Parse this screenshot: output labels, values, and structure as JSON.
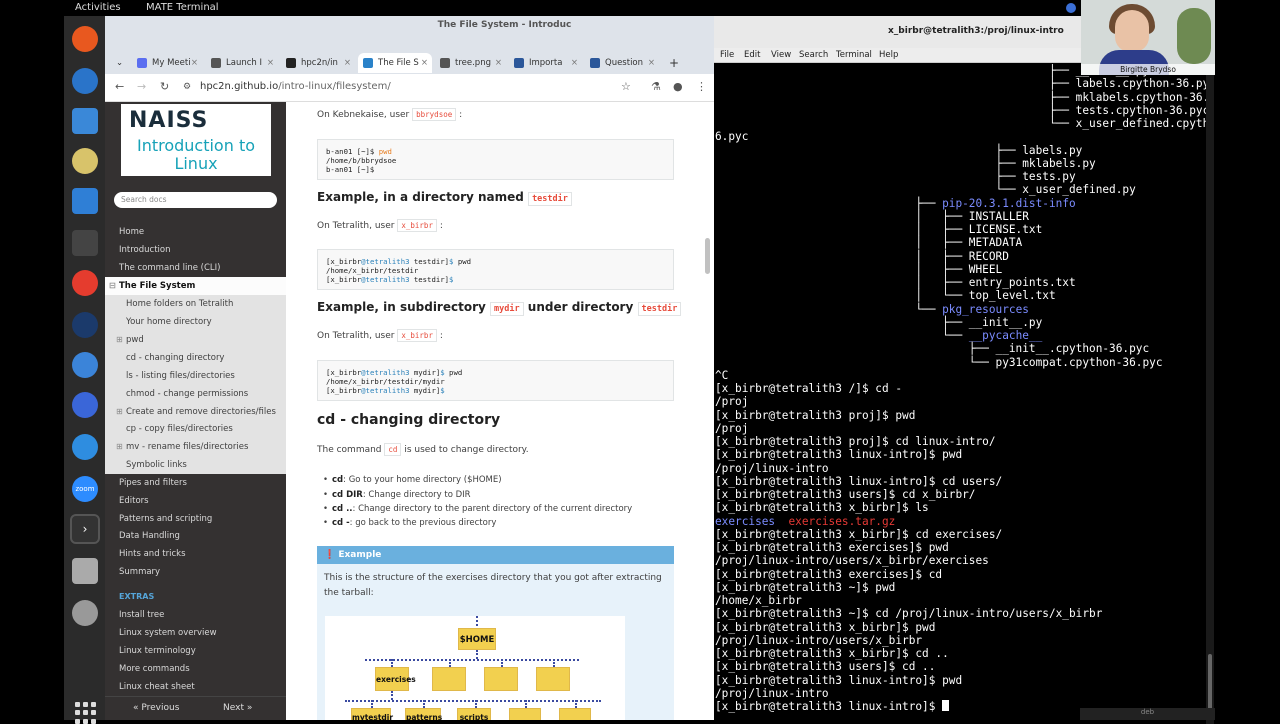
{
  "topbar": {
    "activities": "Activities",
    "app": "MATE Terminal"
  },
  "dock": [
    {
      "name": "firefox-icon",
      "color": "#e8581f"
    },
    {
      "name": "thunderbird-icon",
      "color": "#2a74c9"
    },
    {
      "name": "files-icon",
      "color": "#3a88d8"
    },
    {
      "name": "rhythmbox-icon",
      "color": "#d8c36a"
    },
    {
      "name": "writer-icon",
      "color": "#2f7fd6"
    },
    {
      "name": "system-monitor-icon",
      "color": "#444"
    },
    {
      "name": "help-icon",
      "color": "#e53c2e"
    },
    {
      "name": "steam-icon",
      "color": "#1b3a6b"
    },
    {
      "name": "chromium-icon",
      "color": "#3b84d9"
    },
    {
      "name": "signal-icon",
      "color": "#3a66d8"
    },
    {
      "name": "remote-icon",
      "color": "#2e8de0"
    },
    {
      "name": "zoom-icon",
      "color": "#2d8cff"
    },
    {
      "name": "terminal-icon",
      "color": "#333"
    },
    {
      "name": "usb-creator-icon",
      "color": "#aaa"
    },
    {
      "name": "trash-icon",
      "color": "#999"
    }
  ],
  "browser": {
    "window_title": "The File System - Introduc",
    "tabs": [
      {
        "label": "My Meeti",
        "color": "#5b6ef0"
      },
      {
        "label": "Launch I",
        "color": "#555"
      },
      {
        "label": "hpc2n/in",
        "color": "#222"
      },
      {
        "label": "The File S",
        "color": "#2a82c9"
      },
      {
        "label": "tree.png",
        "color": "#555"
      },
      {
        "label": "Importa",
        "color": "#2b579a"
      },
      {
        "label": "Question",
        "color": "#2b579a"
      }
    ],
    "new_tab": "+",
    "url_host": "hpc2n.github.io",
    "url_path": "/intro-linux/filesystem/"
  },
  "sidebar": {
    "logo_top": "NAISS",
    "logo_bottom": "Introduction to Linux",
    "search_placeholder": "Search docs",
    "items": [
      {
        "label": "Home",
        "kind": "top"
      },
      {
        "label": "Introduction",
        "kind": "top"
      },
      {
        "label": "The command line (CLI)",
        "kind": "top"
      },
      {
        "label": "The File System",
        "kind": "current",
        "toggle": "⊟"
      },
      {
        "label": "Home folders on Tetralith",
        "kind": "sub"
      },
      {
        "label": "Your home directory",
        "kind": "sub"
      },
      {
        "label": "pwd",
        "kind": "sub",
        "toggle": "⊞"
      },
      {
        "label": "cd - changing directory",
        "kind": "sub"
      },
      {
        "label": "ls - listing files/directories",
        "kind": "sub"
      },
      {
        "label": "chmod - change permissions",
        "kind": "sub"
      },
      {
        "label": "Create and remove directories/files",
        "kind": "sub",
        "toggle": "⊞"
      },
      {
        "label": "cp - copy files/directories",
        "kind": "sub"
      },
      {
        "label": "mv - rename files/directories",
        "kind": "sub",
        "toggle": "⊞"
      },
      {
        "label": "Symbolic links",
        "kind": "sub"
      },
      {
        "label": "Pipes and filters",
        "kind": "top"
      },
      {
        "label": "Editors",
        "kind": "top"
      },
      {
        "label": "Patterns and scripting",
        "kind": "top"
      },
      {
        "label": "Data Handling",
        "kind": "top"
      },
      {
        "label": "Hints and tricks",
        "kind": "top"
      },
      {
        "label": "Summary",
        "kind": "top"
      },
      {
        "label": "EXTRAS",
        "kind": "extras"
      },
      {
        "label": "Install tree",
        "kind": "top"
      },
      {
        "label": "Linux system overview",
        "kind": "top"
      },
      {
        "label": "Linux terminology",
        "kind": "top"
      },
      {
        "label": "More commands",
        "kind": "top"
      },
      {
        "label": "Linux cheat sheet",
        "kind": "top"
      }
    ],
    "prev": "« Previous",
    "next": "Next »"
  },
  "content": {
    "p_kebnekaise_pre": "On Kebnekaise, user",
    "user_kebnekaise": "bbrydsoe",
    "p_colon": ":",
    "block1": {
      "l1_prompt": "b-an01 [~]$ ",
      "l1_cmd": "pwd",
      "l2": "/home/b/bbrydsoe",
      "l3": "b-an01 [~]$"
    },
    "h_dir_pre": "Example, in a directory named",
    "h_dir_code": "testdir",
    "p_tetralith_pre": "On Tetralith, user",
    "user_tetralith": "x_birbr",
    "block2": {
      "l1a": "[x_birbr",
      "l1b": "@tetralith3",
      "l1c": " testdir]",
      "l1d": "$ ",
      "l1e": "pwd",
      "l2": "/home/x_birbr/testdir",
      "l3a": "[x_birbr",
      "l3b": "@tetralith3",
      "l3c": " testdir]",
      "l3d": "$"
    },
    "h_sub_pre": "Example, in subdirectory",
    "h_sub_code1": "mydir",
    "h_sub_mid": "under directory",
    "h_sub_code2": "testdir",
    "block3": {
      "l1a": "[x_birbr",
      "l1b": "@tetralith3",
      "l1c": " mydir]",
      "l1d": "$ ",
      "l1e": "pwd",
      "l2": "/home/x_birbr/testdir/mydir",
      "l3a": "[x_birbr",
      "l3b": "@tetralith3",
      "l3c": " mydir]",
      "l3d": "$"
    },
    "h2": "cd - changing directory",
    "p_cmd_pre": "The command",
    "p_cmd_code": "cd",
    "p_cmd_post": "is used to change directory.",
    "bullets": [
      {
        "b": "cd",
        "t": ": Go to your home directory ($HOME)"
      },
      {
        "b": "cd DIR",
        "t": ": Change directory to DIR"
      },
      {
        "b": "cd ..",
        "t": ": Change directory to the parent directory of the current directory"
      },
      {
        "b": "cd -",
        "t": ": go back to the previous directory"
      }
    ],
    "example_head": "Example",
    "example_text": "This is the structure of the exercises directory that you got after extracting the tarball:",
    "tree_labels": {
      "home": "$HOME",
      "exercises": "exercises",
      "mytestdir": "mytestdir",
      "patterns": "patterns",
      "scripts": "scripts"
    }
  },
  "terminal": {
    "title": "x_birbr@tetralith3:/proj/linux-intro",
    "menu": [
      "File",
      "Edit",
      "View",
      "Search",
      "Terminal",
      "Help"
    ]
  },
  "webcam": {
    "name": "Birgitte Brydso"
  },
  "rightfoot": "deb"
}
